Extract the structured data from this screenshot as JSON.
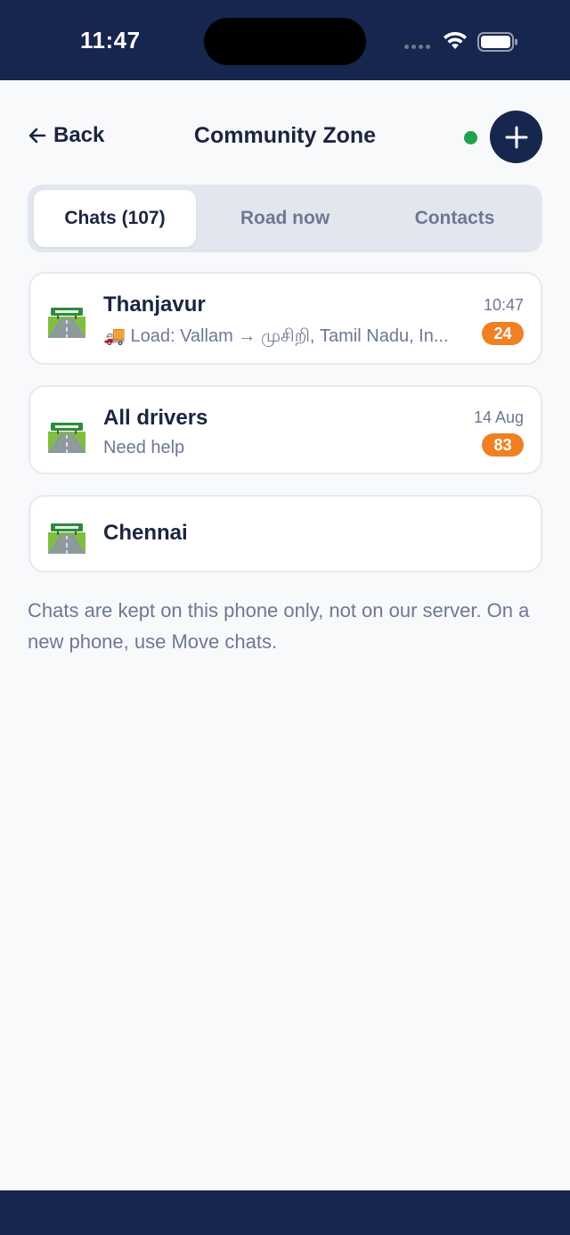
{
  "status": {
    "time": "11:47"
  },
  "header": {
    "back_label": "Back",
    "title": "Community Zone",
    "online_color": "#1fa14f"
  },
  "tabs": [
    {
      "label": "Chats (107)",
      "active": true
    },
    {
      "label": "Road now",
      "active": false
    },
    {
      "label": "Contacts",
      "active": false
    }
  ],
  "chats": [
    {
      "name": "Thanjavur",
      "icon": "motorway-icon",
      "preview_emoji": "🚚",
      "preview": "Load: Vallam → முசிறி, Tamil Nadu, In...",
      "time": "10:47",
      "unread": "24"
    },
    {
      "name": "All drivers",
      "icon": "motorway-icon",
      "preview": "Need help",
      "time": "14 Aug",
      "unread": "83"
    },
    {
      "name": "Chennai",
      "icon": "motorway-icon"
    }
  ],
  "note": "Chats are kept on this phone only, not on our server. On a new phone, use Move chats.",
  "colors": {
    "navy": "#17264e",
    "badge": "#f08022"
  }
}
